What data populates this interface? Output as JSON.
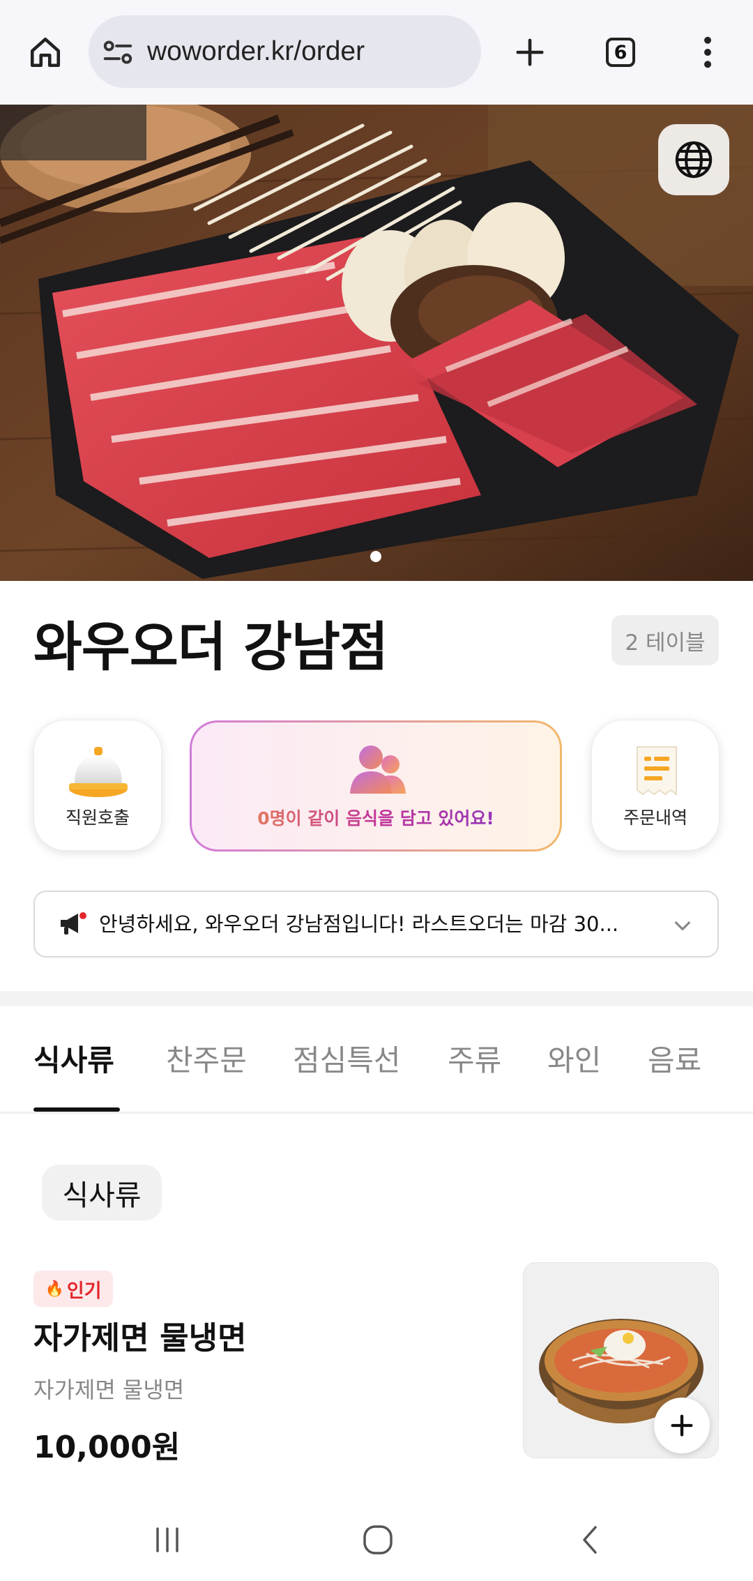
{
  "browser": {
    "url": "woworder.kr/order",
    "tab_count": "6"
  },
  "store": {
    "name": "와우오더 강남점",
    "table": "2 테이블"
  },
  "actions": {
    "call_staff": "직원호출",
    "together_text": "0명이 같이 음식을 담고 있어요!",
    "order_history": "주문내역"
  },
  "notice": {
    "text": "안녕하세요, 와우오더 강남점입니다! 라스트오더는 마감 30..."
  },
  "tabs": [
    {
      "label": "식사류",
      "active": true
    },
    {
      "label": "찬주문",
      "active": false
    },
    {
      "label": "점심특선",
      "active": false
    },
    {
      "label": "주류",
      "active": false
    },
    {
      "label": "와인",
      "active": false
    },
    {
      "label": "음료",
      "active": false
    }
  ],
  "category": {
    "label": "식사류"
  },
  "menu_items": [
    {
      "badge": "인기",
      "name": "자가제면 물냉면",
      "description": "자가제면 물냉면",
      "price": "10,000원"
    }
  ],
  "colors": {
    "popular_badge_bg": "#fde9ea",
    "popular_badge_text": "#e3262d",
    "together_gradient_start": "#f49a3e",
    "together_gradient_end": "#7c33c9"
  }
}
